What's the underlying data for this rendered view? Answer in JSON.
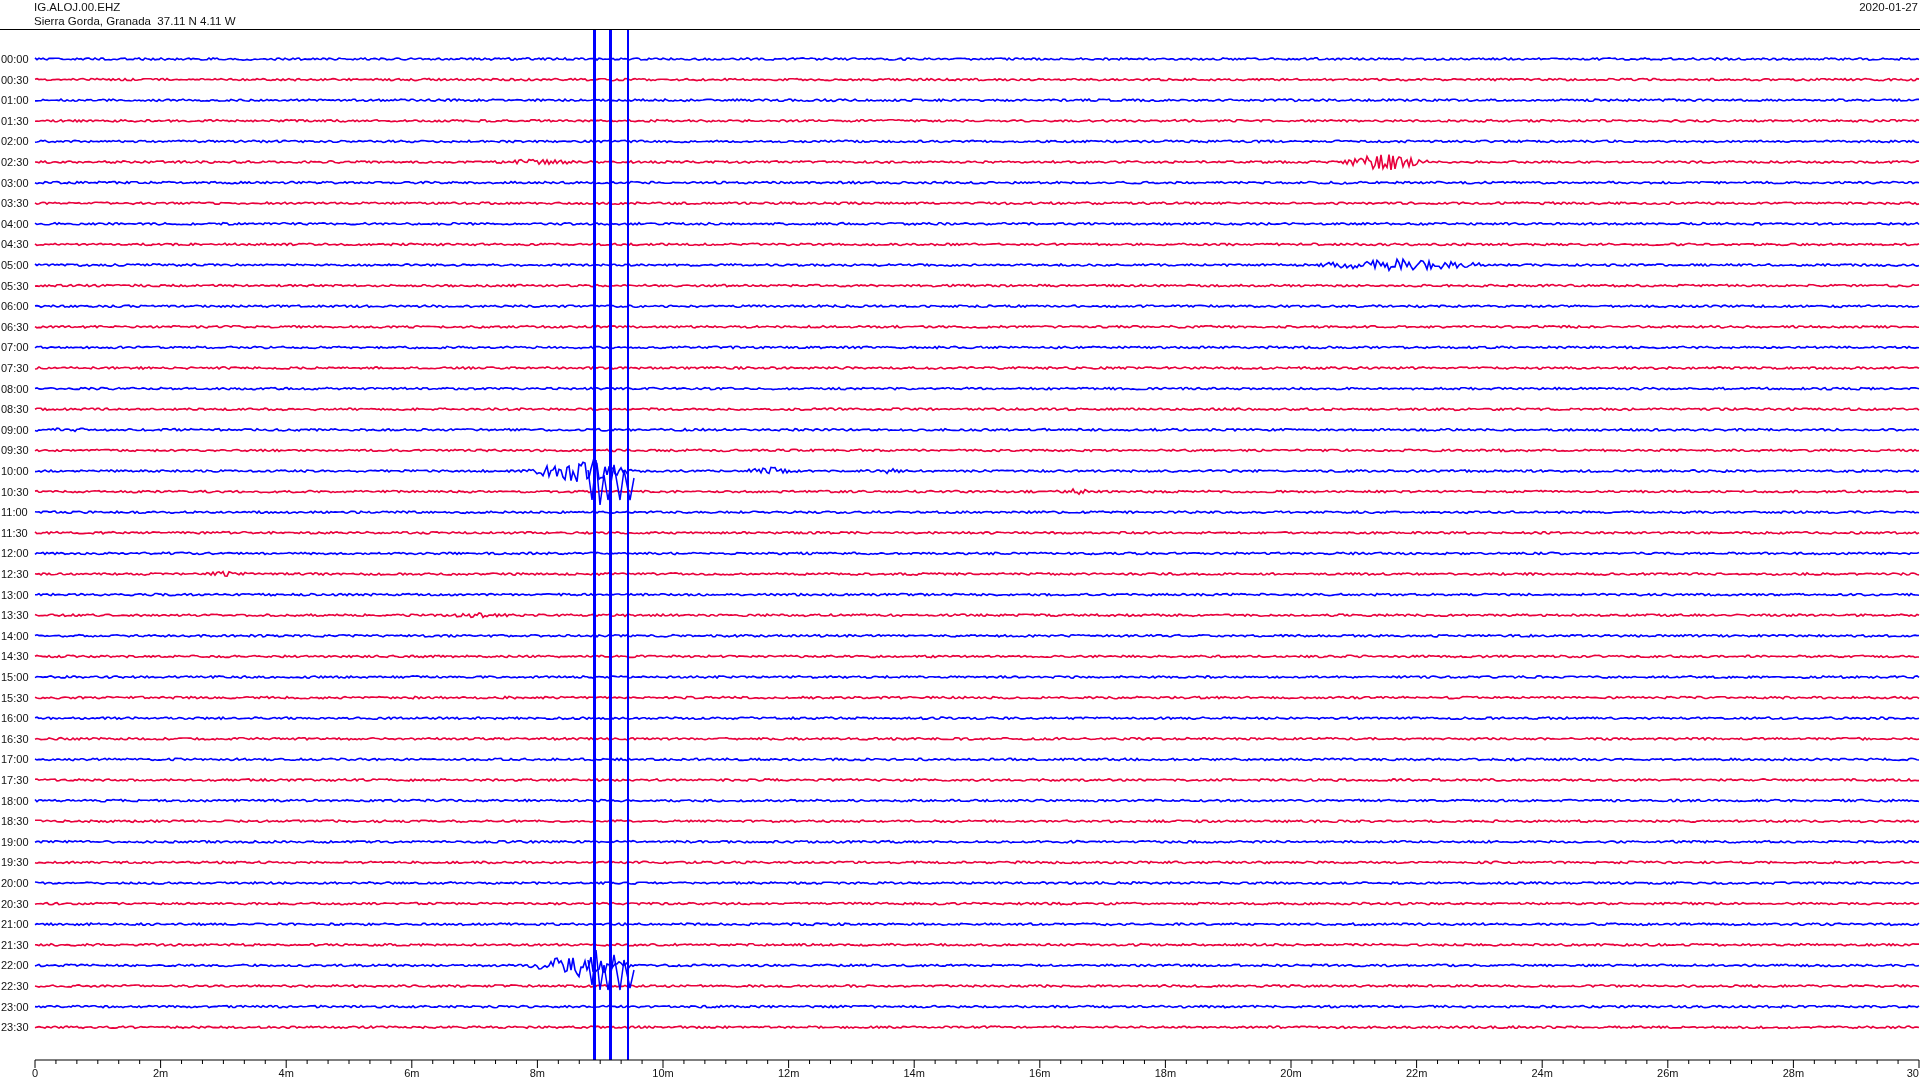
{
  "header": {
    "station": "IG.ALOJ.00.EHZ",
    "location": "Sierra Gorda, Granada  37.11 N 4.11 W",
    "date": "2020-01-27"
  },
  "rows": [
    {
      "time": "00:00",
      "color": "#0000ff"
    },
    {
      "time": "00:30",
      "color": "#e8003c"
    },
    {
      "time": "01:00",
      "color": "#0000ff"
    },
    {
      "time": "01:30",
      "color": "#e8003c"
    },
    {
      "time": "02:00",
      "color": "#0000ff"
    },
    {
      "time": "02:30",
      "color": "#e8003c"
    },
    {
      "time": "03:00",
      "color": "#0000ff"
    },
    {
      "time": "03:30",
      "color": "#e8003c"
    },
    {
      "time": "04:00",
      "color": "#0000ff"
    },
    {
      "time": "04:30",
      "color": "#e8003c"
    },
    {
      "time": "05:00",
      "color": "#0000ff"
    },
    {
      "time": "05:30",
      "color": "#e8003c"
    },
    {
      "time": "06:00",
      "color": "#0000ff"
    },
    {
      "time": "06:30",
      "color": "#e8003c"
    },
    {
      "time": "07:00",
      "color": "#0000ff"
    },
    {
      "time": "07:30",
      "color": "#e8003c"
    },
    {
      "time": "08:00",
      "color": "#0000ff"
    },
    {
      "time": "08:30",
      "color": "#e8003c"
    },
    {
      "time": "09:00",
      "color": "#0000ff"
    },
    {
      "time": "09:30",
      "color": "#e8003c"
    },
    {
      "time": "10:00",
      "color": "#0000ff"
    },
    {
      "time": "10:30",
      "color": "#e8003c"
    },
    {
      "time": "11:00",
      "color": "#0000ff"
    },
    {
      "time": "11:30",
      "color": "#e8003c"
    },
    {
      "time": "12:00",
      "color": "#0000ff"
    },
    {
      "time": "12:30",
      "color": "#e8003c"
    },
    {
      "time": "13:00",
      "color": "#0000ff"
    },
    {
      "time": "13:30",
      "color": "#e8003c"
    },
    {
      "time": "14:00",
      "color": "#0000ff"
    },
    {
      "time": "14:30",
      "color": "#e8003c"
    },
    {
      "time": "15:00",
      "color": "#0000ff"
    },
    {
      "time": "15:30",
      "color": "#e8003c"
    },
    {
      "time": "16:00",
      "color": "#0000ff"
    },
    {
      "time": "16:30",
      "color": "#e8003c"
    },
    {
      "time": "17:00",
      "color": "#0000ff"
    },
    {
      "time": "17:30",
      "color": "#e8003c"
    },
    {
      "time": "18:00",
      "color": "#0000ff"
    },
    {
      "time": "18:30",
      "color": "#e8003c"
    },
    {
      "time": "19:00",
      "color": "#0000ff"
    },
    {
      "time": "19:30",
      "color": "#e8003c"
    },
    {
      "time": "20:00",
      "color": "#0000ff"
    },
    {
      "time": "20:30",
      "color": "#e8003c"
    },
    {
      "time": "21:00",
      "color": "#0000ff"
    },
    {
      "time": "21:30",
      "color": "#e8003c"
    },
    {
      "time": "22:00",
      "color": "#0000ff"
    },
    {
      "time": "22:30",
      "color": "#e8003c"
    },
    {
      "time": "23:00",
      "color": "#0000ff"
    },
    {
      "time": "23:30",
      "color": "#e8003c"
    }
  ],
  "x_axis": {
    "ticks": [
      "0",
      "2m",
      "4m",
      "6m",
      "8m",
      "10m",
      "12m",
      "14m",
      "16m",
      "18m",
      "20m",
      "22m",
      "24m",
      "26m",
      "28m",
      "30"
    ]
  }
}
